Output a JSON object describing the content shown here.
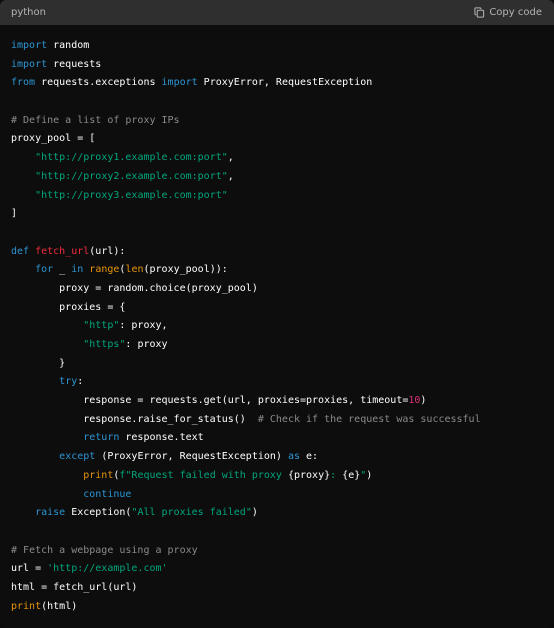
{
  "header": {
    "language": "python",
    "copy_label": "Copy code",
    "copy_icon": "clipboard-icon"
  },
  "code_lines": [
    [
      [
        "kw",
        "import"
      ],
      [
        "plain",
        " random"
      ]
    ],
    [
      [
        "kw",
        "import"
      ],
      [
        "plain",
        " requests"
      ]
    ],
    [
      [
        "kw",
        "from"
      ],
      [
        "plain",
        " requests.exceptions "
      ],
      [
        "kw",
        "import"
      ],
      [
        "plain",
        " ProxyError, RequestException"
      ]
    ],
    [],
    [
      [
        "cm",
        "# Define a list of proxy IPs"
      ]
    ],
    [
      [
        "plain",
        "proxy_pool = ["
      ]
    ],
    [
      [
        "plain",
        "    "
      ],
      [
        "str",
        "\"http://proxy1.example.com:port\""
      ],
      [
        "plain",
        ","
      ]
    ],
    [
      [
        "plain",
        "    "
      ],
      [
        "str",
        "\"http://proxy2.example.com:port\""
      ],
      [
        "plain",
        ","
      ]
    ],
    [
      [
        "plain",
        "    "
      ],
      [
        "str",
        "\"http://proxy3.example.com:port\""
      ]
    ],
    [
      [
        "plain",
        "]"
      ]
    ],
    [],
    [
      [
        "kw",
        "def"
      ],
      [
        "plain",
        " "
      ],
      [
        "fn",
        "fetch_url"
      ],
      [
        "plain",
        "(url):"
      ]
    ],
    [
      [
        "plain",
        "    "
      ],
      [
        "kw",
        "for"
      ],
      [
        "plain",
        " _ "
      ],
      [
        "kw",
        "in"
      ],
      [
        "plain",
        " "
      ],
      [
        "bi",
        "range"
      ],
      [
        "plain",
        "("
      ],
      [
        "bi",
        "len"
      ],
      [
        "plain",
        "(proxy_pool)):"
      ]
    ],
    [
      [
        "plain",
        "        proxy = random.choice(proxy_pool)"
      ]
    ],
    [
      [
        "plain",
        "        proxies = {"
      ]
    ],
    [
      [
        "plain",
        "            "
      ],
      [
        "str",
        "\"http\""
      ],
      [
        "plain",
        ": proxy,"
      ]
    ],
    [
      [
        "plain",
        "            "
      ],
      [
        "str",
        "\"https\""
      ],
      [
        "plain",
        ": proxy"
      ]
    ],
    [
      [
        "plain",
        "        }"
      ]
    ],
    [
      [
        "plain",
        "        "
      ],
      [
        "kw",
        "try"
      ],
      [
        "plain",
        ":"
      ]
    ],
    [
      [
        "plain",
        "            response = requests.get(url, proxies=proxies, timeout="
      ],
      [
        "num",
        "10"
      ],
      [
        "plain",
        ")"
      ]
    ],
    [
      [
        "plain",
        "            response.raise_for_status()  "
      ],
      [
        "cm",
        "# Check if the request was successful"
      ]
    ],
    [
      [
        "plain",
        "            "
      ],
      [
        "kw",
        "return"
      ],
      [
        "plain",
        " response.text"
      ]
    ],
    [
      [
        "plain",
        "        "
      ],
      [
        "kw",
        "except"
      ],
      [
        "plain",
        " (ProxyError, RequestException) "
      ],
      [
        "kw",
        "as"
      ],
      [
        "plain",
        " e:"
      ]
    ],
    [
      [
        "plain",
        "            "
      ],
      [
        "bi",
        "print"
      ],
      [
        "plain",
        "("
      ],
      [
        "str",
        "f\"Request failed with proxy "
      ],
      [
        "plain",
        "{proxy}"
      ],
      [
        "str",
        ": "
      ],
      [
        "plain",
        "{e}"
      ],
      [
        "str",
        "\""
      ],
      [
        "plain",
        ")"
      ]
    ],
    [
      [
        "plain",
        "            "
      ],
      [
        "kw",
        "continue"
      ]
    ],
    [
      [
        "plain",
        "    "
      ],
      [
        "kw",
        "raise"
      ],
      [
        "plain",
        " Exception("
      ],
      [
        "str",
        "\"All proxies failed\""
      ],
      [
        "plain",
        ")"
      ]
    ],
    [],
    [
      [
        "cm",
        "# Fetch a webpage using a proxy"
      ]
    ],
    [
      [
        "plain",
        "url = "
      ],
      [
        "str",
        "'http://example.com'"
      ]
    ],
    [
      [
        "plain",
        "html = fetch_url(url)"
      ]
    ],
    [
      [
        "bi",
        "print"
      ],
      [
        "plain",
        "(html)"
      ]
    ]
  ],
  "colors": {
    "keyword": "#2e95d3",
    "string": "#00a67d",
    "comment": "#8a8a8a",
    "function_name": "#f22c3d",
    "builtin": "#e9950c",
    "number": "#df3079",
    "background": "#0d0d0d",
    "header_background": "#2f2f2f"
  }
}
